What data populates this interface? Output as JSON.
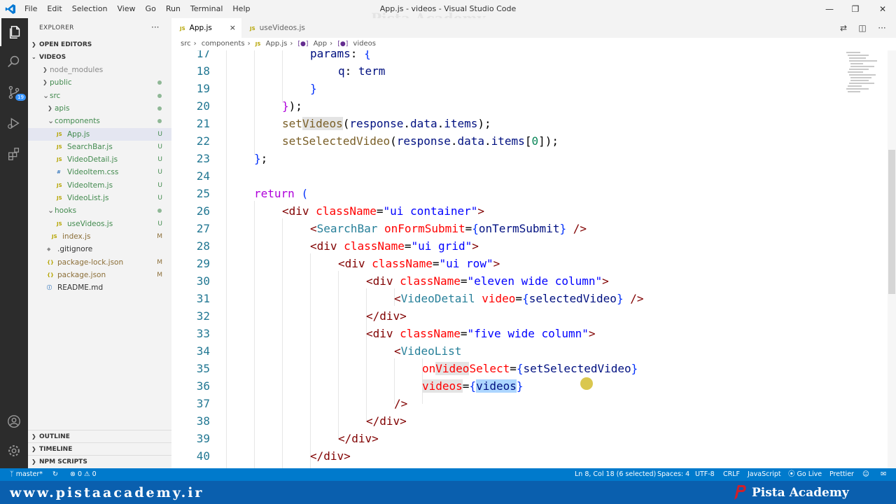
{
  "titlebar": {
    "menu": [
      "File",
      "Edit",
      "Selection",
      "View",
      "Go",
      "Run",
      "Terminal",
      "Help"
    ],
    "title": "App.js - videos - Visual Studio Code",
    "watermark": "Pista Academy"
  },
  "sidebar": {
    "header": "EXPLORER",
    "more": "···",
    "open_editors": "OPEN EDITORS",
    "root": "VIDEOS",
    "tree": [
      {
        "name": "node_modules",
        "kind": "folder",
        "status": "",
        "color": "gray"
      },
      {
        "name": "public",
        "kind": "folder",
        "status": "dot",
        "color": "green"
      },
      {
        "name": "src",
        "kind": "folder",
        "status": "dot",
        "color": "green"
      },
      {
        "name": "apis",
        "kind": "folder",
        "status": "dot",
        "color": "green"
      },
      {
        "name": "components",
        "kind": "folder",
        "status": "dot",
        "color": "green"
      },
      {
        "name": "App.js",
        "kind": "js",
        "status": "U",
        "color": "green"
      },
      {
        "name": "SearchBar.js",
        "kind": "js",
        "status": "U",
        "color": "green"
      },
      {
        "name": "VideoDetail.js",
        "kind": "js",
        "status": "U",
        "color": "green"
      },
      {
        "name": "VideoItem.css",
        "kind": "css",
        "status": "U",
        "color": "green"
      },
      {
        "name": "VideoItem.js",
        "kind": "js",
        "status": "U",
        "color": "green"
      },
      {
        "name": "VideoList.js",
        "kind": "js",
        "status": "U",
        "color": "green"
      },
      {
        "name": "hooks",
        "kind": "folder",
        "status": "dot",
        "color": "green"
      },
      {
        "name": "useVideos.js",
        "kind": "js",
        "status": "U",
        "color": "green"
      },
      {
        "name": "index.js",
        "kind": "js",
        "status": "M",
        "color": "brown"
      },
      {
        "name": ".gitignore",
        "kind": "git",
        "status": "",
        "color": "plain"
      },
      {
        "name": "package-lock.json",
        "kind": "json",
        "status": "M",
        "color": "brown"
      },
      {
        "name": "package.json",
        "kind": "json",
        "status": "M",
        "color": "brown"
      },
      {
        "name": "README.md",
        "kind": "info",
        "status": "",
        "color": "plain"
      }
    ],
    "bottom_sections": [
      "OUTLINE",
      "TIMELINE",
      "NPM SCRIPTS"
    ]
  },
  "tabs": [
    {
      "label": "App.js",
      "icon": "JS",
      "active": true,
      "close": "×"
    },
    {
      "label": "useVideos.js",
      "icon": "JS",
      "active": false
    }
  ],
  "breadcrumb": [
    "src",
    "components",
    "JS",
    "App.js",
    "App",
    "videos"
  ],
  "code": {
    "line_numbers": [
      "17",
      "18",
      "19",
      "20",
      "21",
      "22",
      "23",
      "24",
      "25",
      "26",
      "27",
      "28",
      "29",
      "30",
      "31",
      "32",
      "33",
      "34",
      "35",
      "36",
      "37",
      "38",
      "39",
      "40"
    ]
  },
  "statusbar": {
    "branch": "master*",
    "problems": "⊗ 0 ⚠ 0",
    "position": "Ln 8, Col 18 (6 selected)",
    "spaces": "Spaces: 4",
    "encoding": "UTF-8",
    "eol": "CRLF",
    "language": "JavaScript",
    "golive": "Go Live",
    "prettier": "Prettier"
  },
  "watermark": {
    "url": "www.pistaacademy.ir",
    "brand": "Pista Academy"
  },
  "colors": {
    "accent": "#007acc",
    "activitybar": "#2c2c2c",
    "sidebar": "#f3f3f3",
    "watermark_bar": "#0a5fae"
  }
}
